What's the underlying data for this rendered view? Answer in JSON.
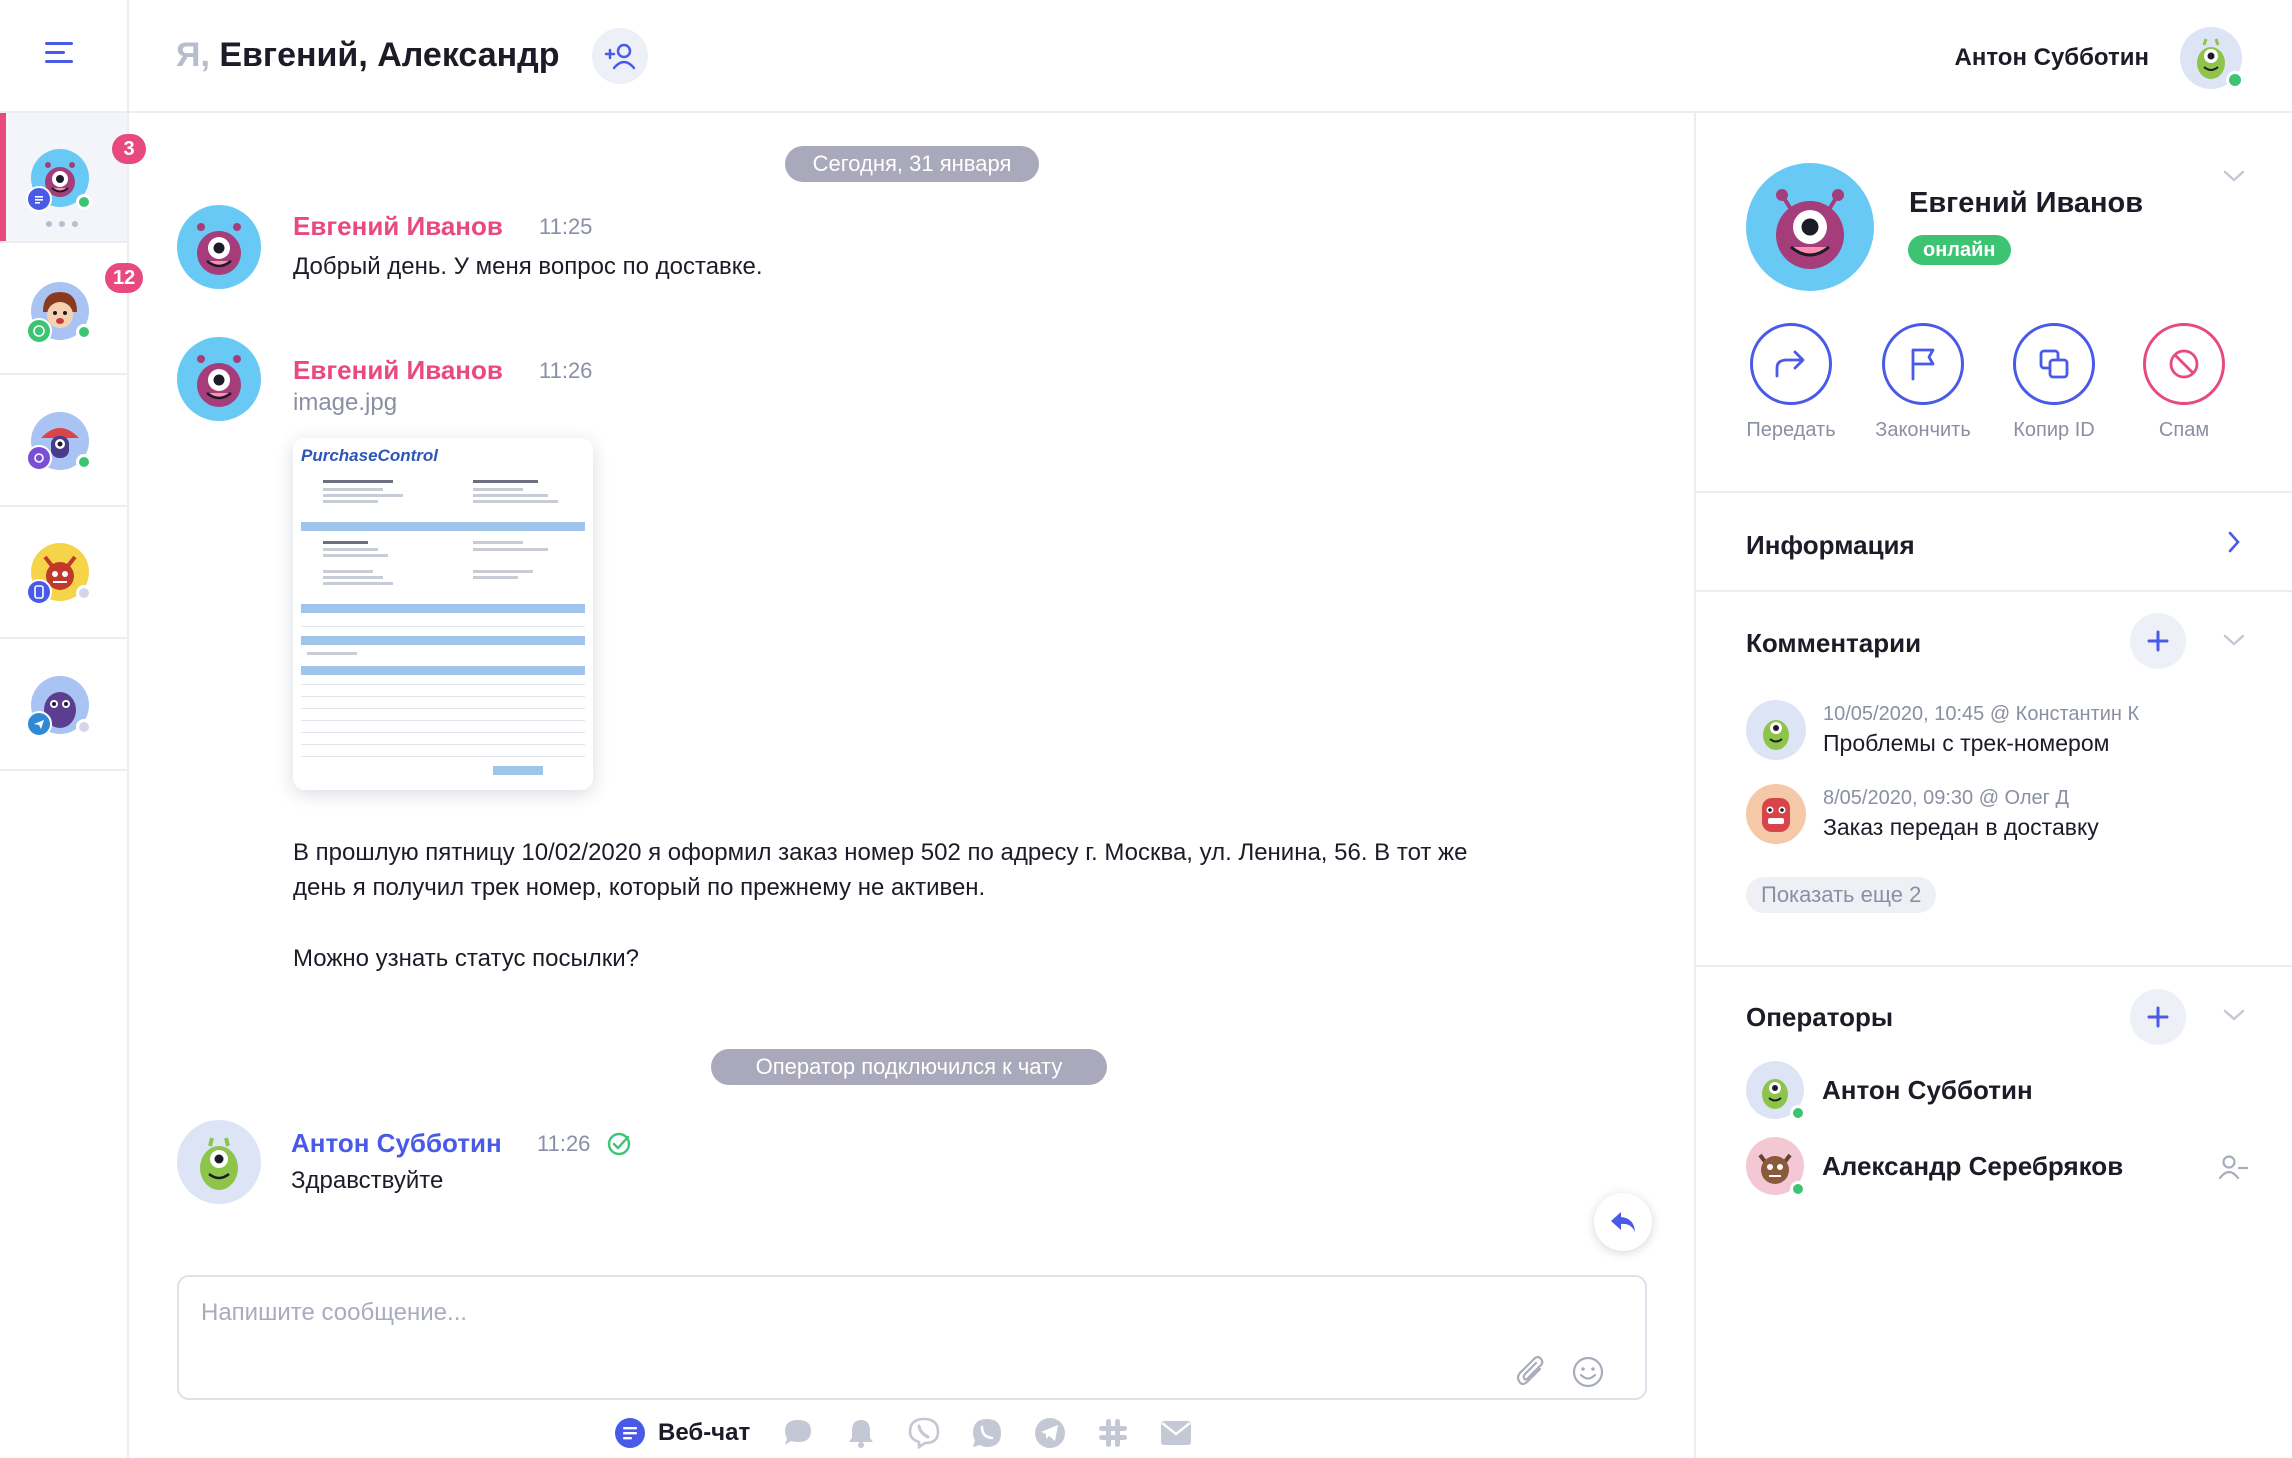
{
  "header": {
    "title_me": "Я,",
    "title_names": "Евгений, Александр",
    "operator_name": "Антон Субботин"
  },
  "sidebar": {
    "conversations": [
      {
        "channel": "web-chat",
        "status": "online",
        "badge": "3",
        "typing": true
      },
      {
        "channel": "whatsapp",
        "status": "online",
        "badge": "12",
        "typing": false
      },
      {
        "channel": "viber",
        "status": "online",
        "badge": "",
        "typing": false
      },
      {
        "channel": "mobile",
        "status": "offline",
        "badge": "",
        "typing": false
      },
      {
        "channel": "telegram",
        "status": "offline",
        "badge": "",
        "typing": false
      }
    ]
  },
  "chat": {
    "date_divider": "Сегодня, 31 января",
    "messages": [
      {
        "author": "Евгений Иванов",
        "time": "11:25",
        "text": "Добрый день. У меня вопрос по доставке."
      },
      {
        "author": "Евгений Иванов",
        "time": "11:26",
        "file_name": "image.jpg",
        "attachment_logo": "PurchaseControl",
        "text_line1": "В прошлую пятницу 10/02/2020 я оформил заказ номер 502 по адресу г. Москва, ул. Ленина, 56. В тот же",
        "text_line2": "день я получил трек номер, который по прежнему не активен.",
        "text_line3": "Можно узнать статус посылки?"
      },
      {
        "author": "Антон Субботин",
        "time": "11:26",
        "text": "Здравствуйте",
        "delivered": true
      }
    ],
    "system_event": "Оператор подключился к чату",
    "composer": {
      "placeholder": "Напишите сообщение..."
    },
    "channels": {
      "active_label": "Веб-чат",
      "items": [
        "web-chat-icon",
        "chat-bubble-icon",
        "bell-icon",
        "viber-icon",
        "whatsapp-icon",
        "telegram-icon",
        "slack-icon",
        "mail-icon"
      ]
    }
  },
  "panel": {
    "profile": {
      "name": "Евгений Иванов",
      "status": "онлайн"
    },
    "actions": {
      "forward": "Передать",
      "finish": "Закончить",
      "copy_id": "Копир ID",
      "spam": "Спам"
    },
    "info": {
      "title": "Информация"
    },
    "comments": {
      "title": "Комментарии",
      "items": [
        {
          "meta": "10/05/2020, 10:45 @ Константин К",
          "text": "Проблемы с трек-номером"
        },
        {
          "meta": "8/05/2020, 09:30 @ Олег Д",
          "text": "Заказ передан в доставку"
        }
      ],
      "show_more": "Показать еще 2"
    },
    "operators": {
      "title": "Операторы",
      "items": [
        {
          "name": "Антон Субботин",
          "status": "online"
        },
        {
          "name": "Александр Серебряков",
          "status": "online"
        }
      ]
    }
  },
  "colors": {
    "accent": "#4a5ae8",
    "pink": "#e8497f",
    "green": "#3cc473",
    "muted": "#8a8fa3"
  }
}
